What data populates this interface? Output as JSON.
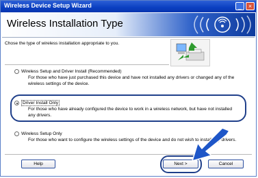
{
  "window": {
    "title": "Wireless Device Setup Wizard",
    "header_title": "Wireless Installation Type",
    "instruction": "Chose the type of wireless installation appropriate to you."
  },
  "options": [
    {
      "label": "Wireless Setup and Driver Install (Recommended)",
      "desc": "For those who have just purchased this device and have not installed any drivers or changed any of the wireless settings of the device.",
      "selected": false
    },
    {
      "label": "Driver Install Only",
      "desc": "For those who have already configured the device to work in a wireless network, but have not installed any drivers.",
      "selected": true
    },
    {
      "label": "Wireless Setup Only",
      "desc": "For those who want to configure the wireless settings of the device and do not wish to install any drivers.",
      "selected": false
    }
  ],
  "buttons": {
    "help": "Help",
    "next": "Next >",
    "cancel": "Cancel"
  },
  "colors": {
    "titlebar": "#0a3fc0",
    "highlight": "#1f3f8a",
    "arrow": "#1e56c8"
  },
  "icons": [
    "minimize-icon",
    "close-icon",
    "wifi-logo-icon",
    "computer-printer-graphic",
    "pointer-arrow-icon"
  ]
}
